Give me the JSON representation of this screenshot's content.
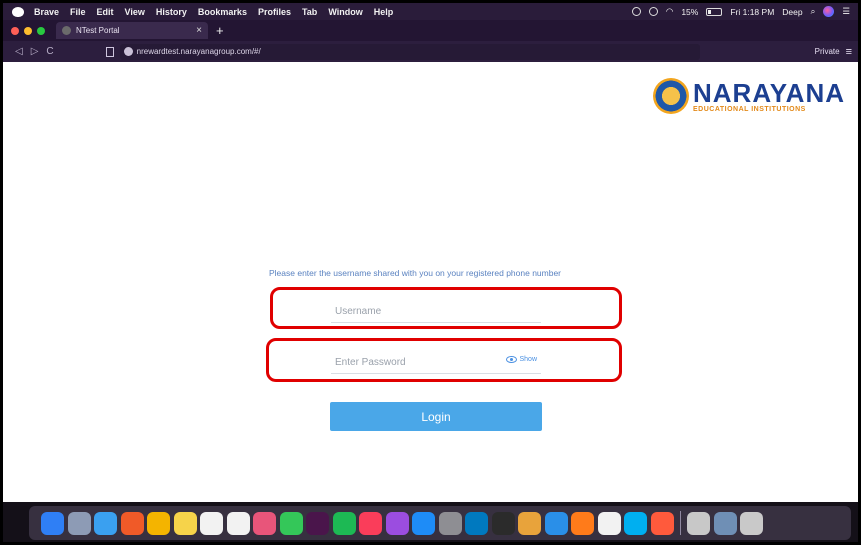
{
  "menubar": {
    "app_name": "Brave",
    "items": [
      "File",
      "Edit",
      "View",
      "History",
      "Bookmarks",
      "Profiles",
      "Tab",
      "Window",
      "Help"
    ],
    "battery": "15%",
    "clock": "Fri 1:18 PM",
    "user": "Deep"
  },
  "browser": {
    "tab_title": "NTest Portal",
    "tab_close": "×",
    "new_tab": "+",
    "back": "◁",
    "forward": "▷",
    "reload": "C",
    "url": "nrewardtest.narayanagroup.com/#/",
    "private_label": "Private",
    "menu_icon": "≡"
  },
  "page": {
    "logo_text": "NARAYANA",
    "logo_subtext": "EDUCATIONAL INSTITUTIONS",
    "hint": "Please enter the username shared with you on your registered phone number",
    "username_placeholder": "Username",
    "password_placeholder": "Enter Password",
    "show_label": "Show",
    "login_label": "Login"
  },
  "colors": {
    "highlight": "#e00000",
    "login_button": "#4aa7e8",
    "logo_blue": "#1c3f91",
    "logo_orange": "#e38a1a"
  },
  "dock": {
    "apps": [
      {
        "name": "finder-icon",
        "color": "#2f7ff5"
      },
      {
        "name": "launchpad-icon",
        "color": "#8d9bb5"
      },
      {
        "name": "safari-icon",
        "color": "#3aa0f0"
      },
      {
        "name": "brave-icon",
        "color": "#f05a28"
      },
      {
        "name": "chrome-icon",
        "color": "#f4b400"
      },
      {
        "name": "notes-icon",
        "color": "#f6d34a"
      },
      {
        "name": "calendar-icon",
        "color": "#f2f2f2"
      },
      {
        "name": "reminders-icon",
        "color": "#f2f2f2"
      },
      {
        "name": "photos-icon",
        "color": "#e8557a"
      },
      {
        "name": "facetime-icon",
        "color": "#34c759"
      },
      {
        "name": "slack-icon",
        "color": "#4a154b"
      },
      {
        "name": "spotify-icon",
        "color": "#1db954"
      },
      {
        "name": "music-icon",
        "color": "#fa3d5a"
      },
      {
        "name": "podcasts-icon",
        "color": "#9b4de0"
      },
      {
        "name": "app-store-icon",
        "color": "#1e8cf7"
      },
      {
        "name": "system-preferences-icon",
        "color": "#8e8e93"
      },
      {
        "name": "trello-icon",
        "color": "#0079bf"
      },
      {
        "name": "terminal-icon",
        "color": "#2b2b2b"
      },
      {
        "name": "pigeon-app-icon",
        "color": "#e8a33b"
      },
      {
        "name": "vscode-icon",
        "color": "#2a8fe8"
      },
      {
        "name": "firefox-icon",
        "color": "#ff7b1a"
      },
      {
        "name": "postman-icon",
        "color": "#f2f2f2"
      },
      {
        "name": "skype-icon",
        "color": "#00aff0"
      },
      {
        "name": "compass-app-icon",
        "color": "#ff5a3c"
      }
    ],
    "extras": [
      {
        "name": "keychain-icon",
        "color": "#c8c8c8"
      },
      {
        "name": "preview-icon",
        "color": "#6f8fb5"
      },
      {
        "name": "trash-icon",
        "color": "#c9c9c9"
      }
    ]
  }
}
